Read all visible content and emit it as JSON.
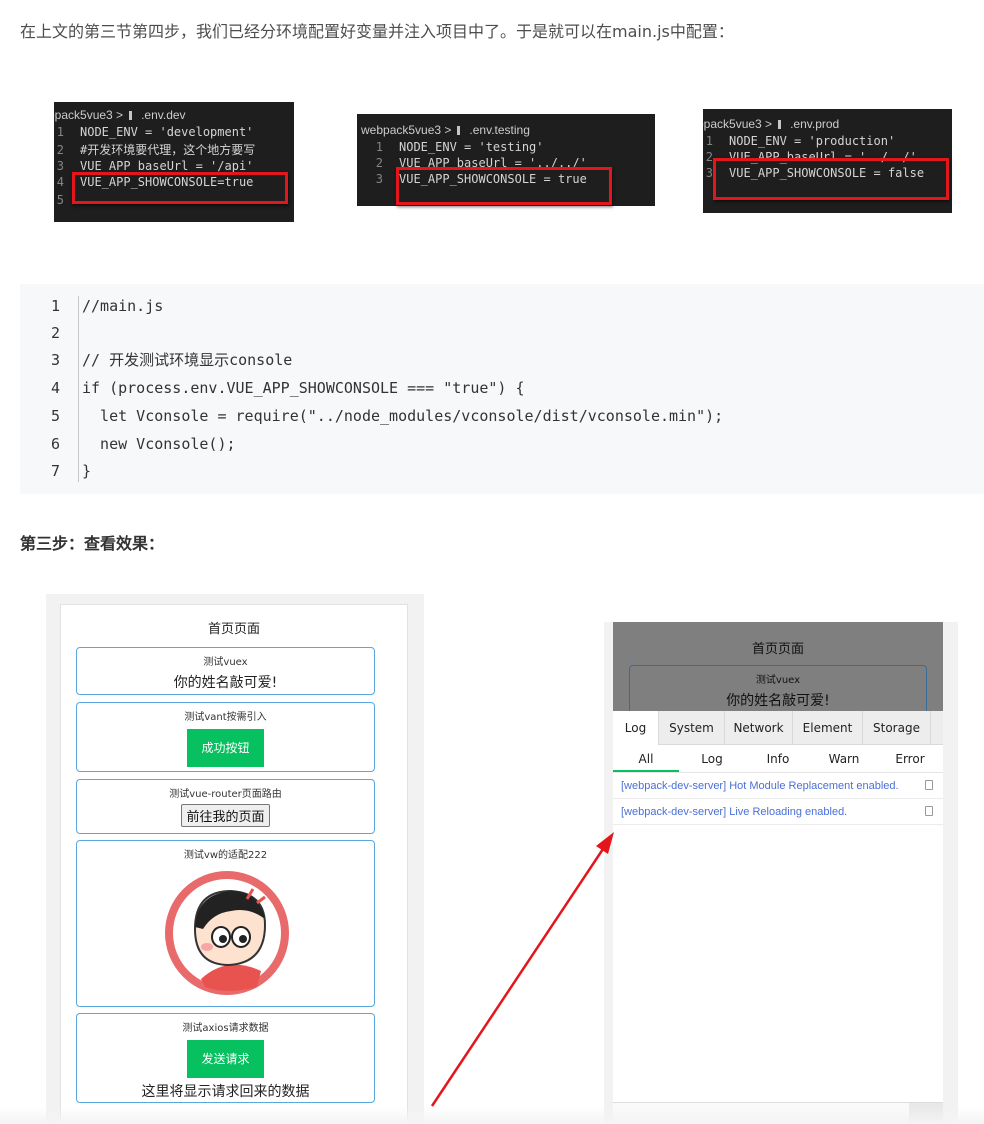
{
  "intro": "在上文的第三节第四步，我们已经分环境配置好变量并注入项目中了。于是就可以在main.js中配置：",
  "editors": {
    "dev": {
      "crumb_project": "bpack5vue3 >",
      "crumb_file": ".env.dev",
      "lines": [
        {
          "num": "1",
          "code": "NODE_ENV = 'development'"
        },
        {
          "num": "2",
          "code": "#开发环境要代理，这个地方要写"
        },
        {
          "num": "3",
          "code": "VUE_APP_baseUrl = '/api'"
        },
        {
          "num": "4",
          "code": "VUE_APP_SHOWCONSOLE=true"
        },
        {
          "num": "5",
          "code": ""
        }
      ]
    },
    "testing": {
      "crumb_project": "webpack5vue3 >",
      "crumb_file": ".env.testing",
      "lines": [
        {
          "num": "1",
          "code": "NODE_ENV = 'testing'"
        },
        {
          "num": "2",
          "code": "VUE_APP_baseUrl = '../../'"
        },
        {
          "num": "3",
          "code": "VUE_APP_SHOWCONSOLE = true"
        }
      ]
    },
    "prod": {
      "crumb_project": "bpack5vue3 >",
      "crumb_file": ".env.prod",
      "lines": [
        {
          "num": "1",
          "code": "NODE_ENV = 'production'"
        },
        {
          "num": "2",
          "code": "VUE_APP_baseUrl = '../../'"
        },
        {
          "num": "3",
          "code": "VUE_APP_SHOWCONSOLE = false"
        }
      ]
    }
  },
  "code": {
    "lines": [
      {
        "num": "1",
        "text": "//main.js"
      },
      {
        "num": "2",
        "text": ""
      },
      {
        "num": "3",
        "text": "// 开发测试环境显示console"
      },
      {
        "num": "4",
        "text": "if (process.env.VUE_APP_SHOWCONSOLE === \"true\") {"
      },
      {
        "num": "5",
        "text": "  let Vconsole = require(\"../node_modules/vconsole/dist/vconsole.min\");"
      },
      {
        "num": "6",
        "text": "  new Vconsole();"
      },
      {
        "num": "7",
        "text": "}"
      }
    ]
  },
  "step_heading": "第三步：查看效果：",
  "phone1": {
    "title": "首页页面",
    "vuex": {
      "title": "测试vuex",
      "text": "你的姓名敲可爱!"
    },
    "vant": {
      "title": "测试vant按需引入",
      "button": "成功按钮"
    },
    "router": {
      "title": "测试vue-router页面路由",
      "button": "前往我的页面"
    },
    "vw": {
      "title": "测试vw的适配222"
    },
    "axios": {
      "title": "测试axios请求数据",
      "button": "发送请求",
      "text": "这里将显示请求回来的数据"
    }
  },
  "phone2": {
    "title": "首页页面",
    "vuex_title": "测试vuex",
    "vuex_text": "你的姓名敲可爱!",
    "tabs": [
      "Log",
      "System",
      "Network",
      "Element",
      "Storage"
    ],
    "subtabs": [
      "All",
      "Log",
      "Info",
      "Warn",
      "Error"
    ],
    "logs": [
      "[webpack-dev-server] Hot Module Replacement enabled.",
      "[webpack-dev-server] Live Reloading enabled."
    ]
  },
  "colors": {
    "highlight_box": "#e3161c",
    "arrow": "#e3161c",
    "vant_green": "#07c160",
    "log_text": "#4a6fd9"
  }
}
